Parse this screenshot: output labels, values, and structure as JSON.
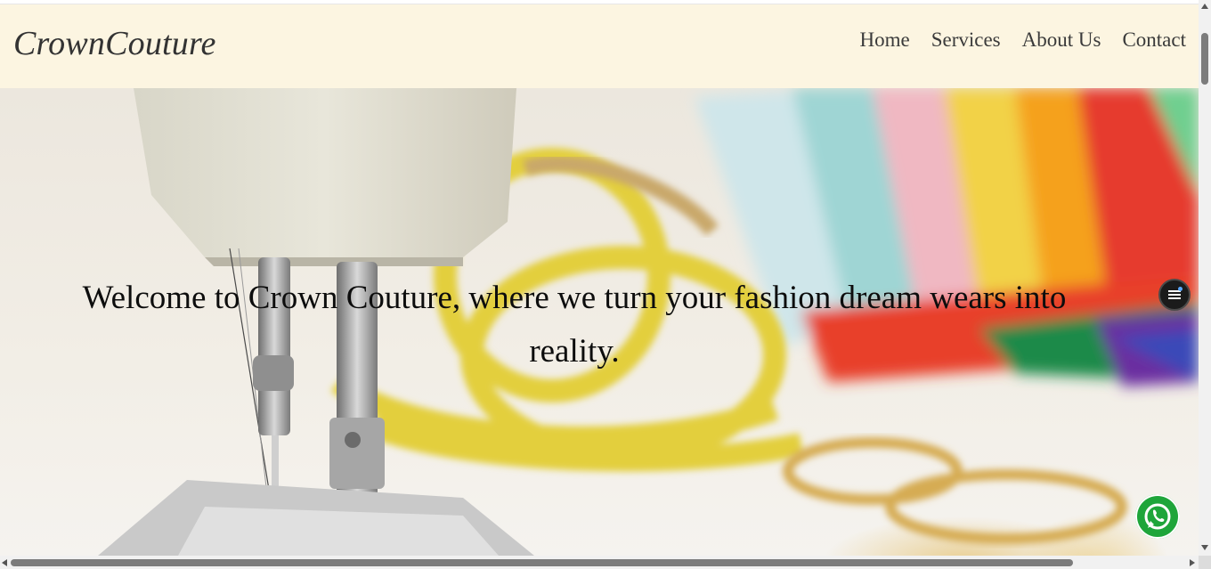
{
  "brand": {
    "name": "CrownCouture"
  },
  "nav": {
    "items": [
      {
        "label": "Home"
      },
      {
        "label": "Services"
      },
      {
        "label": "About Us"
      },
      {
        "label": "Contact"
      }
    ]
  },
  "hero": {
    "headline": "Welcome to Crown Couture, where we turn your fashion dream wears into reality.",
    "background_image": "sewing-machine-with-measuring-tape-and-fabrics"
  },
  "floating": {
    "menu_icon": "menu-lines-icon",
    "chat_icon": "whatsapp-icon"
  },
  "colors": {
    "navbar_bg": "#fcf5e1",
    "whatsapp_green": "#1ea53a"
  }
}
